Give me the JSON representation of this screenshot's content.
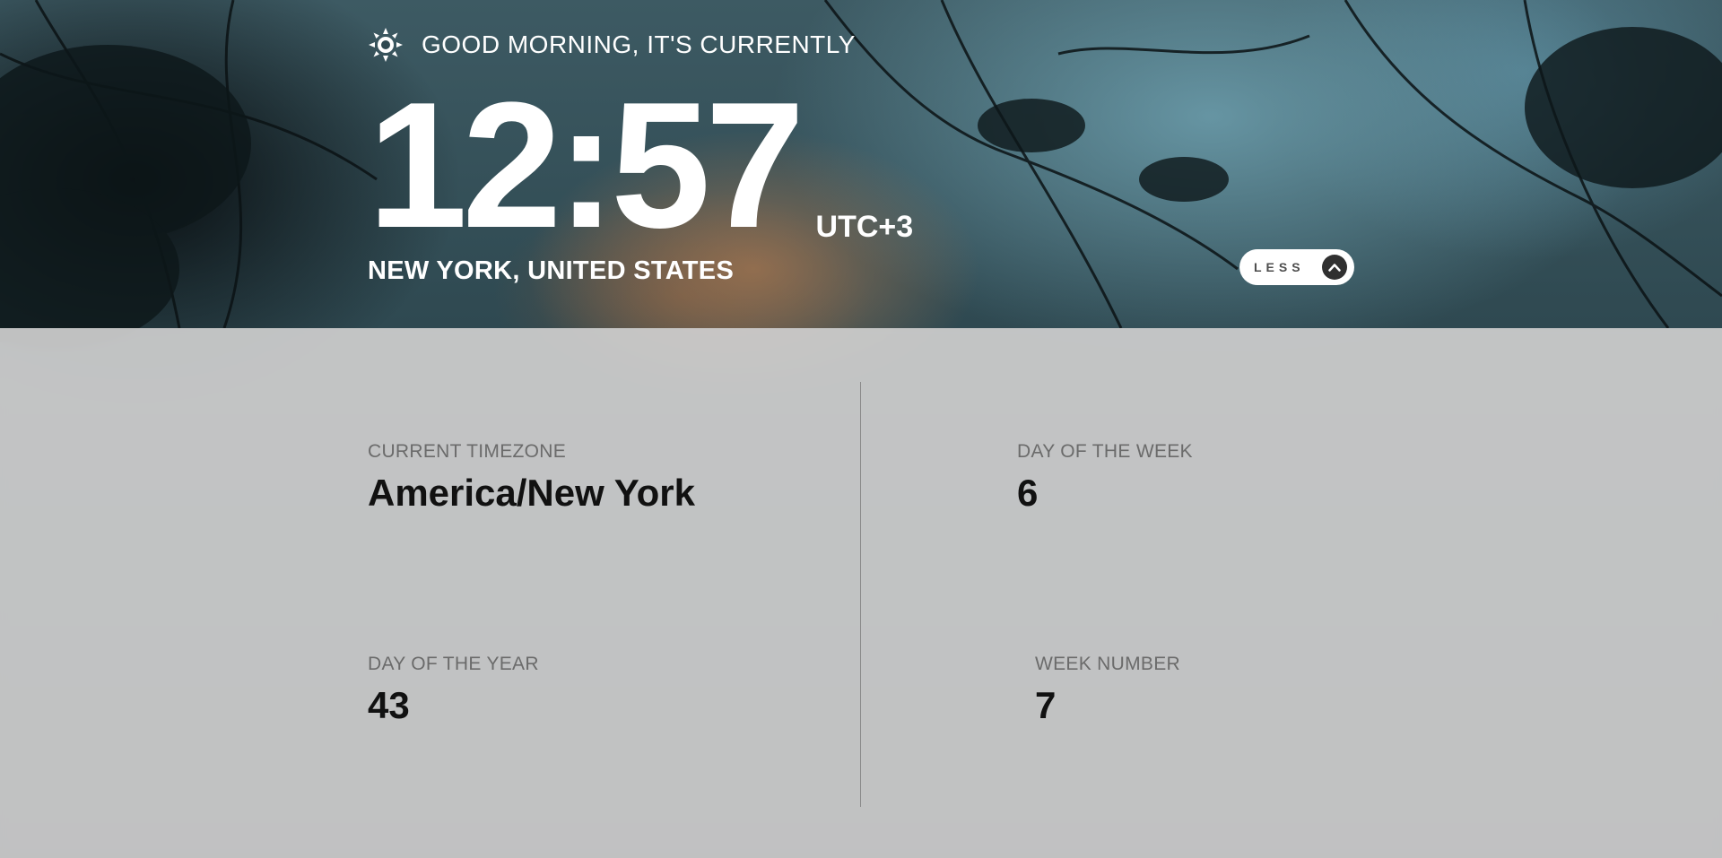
{
  "greeting": {
    "text": "GOOD MORNING, IT'S CURRENTLY",
    "icon": "sun-icon"
  },
  "clock": {
    "time": "12:57",
    "abbreviation": "UTC+3"
  },
  "location": "NEW YORK, UNITED STATES",
  "toggle": {
    "label": "LESS",
    "icon": "chevron-up-icon"
  },
  "details": {
    "timezone": {
      "label": "CURRENT TIMEZONE",
      "value": "America/New York"
    },
    "day_of_week": {
      "label": "DAY OF THE WEEK",
      "value": "6"
    },
    "day_of_year": {
      "label": "DAY OF THE YEAR",
      "value": "43"
    },
    "week_number": {
      "label": "WEEK NUMBER",
      "value": "7"
    }
  },
  "colors": {
    "text_light": "#ffffff",
    "panel_bg": "#cdcdcd",
    "label_gray": "#6b6b6b",
    "value_dark": "#111111",
    "button_icon_bg": "#303030"
  }
}
